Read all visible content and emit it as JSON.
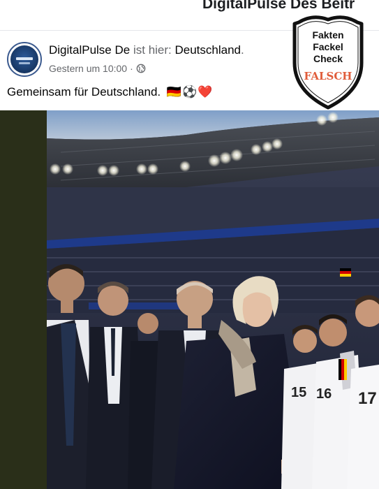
{
  "header": {
    "title": "DigitalPulse Des Beitr"
  },
  "post": {
    "author": "DigitalPulse De",
    "location_connector": "ist hier:",
    "location": "Deutschland",
    "location_suffix": ".",
    "time": "Gestern um 10:00",
    "separator": "·",
    "privacy_icon": "globe-icon",
    "text": "Gemeinsam für Deutschland.",
    "emojis": [
      "flag-germany",
      "soccer-ball",
      "red-heart"
    ],
    "emoji_text": "🇩🇪⚽❤️"
  },
  "badge": {
    "line1": "Fakten",
    "line2": "Fackel",
    "line3": "Check",
    "verdict": "FALSCH",
    "verdict_color": "#e05c3a"
  },
  "photo": {
    "player_numbers": [
      "15",
      "16",
      "17"
    ]
  },
  "colors": {
    "side_strip": "#2a2f19",
    "text": "#050505",
    "meta": "#65676b"
  }
}
